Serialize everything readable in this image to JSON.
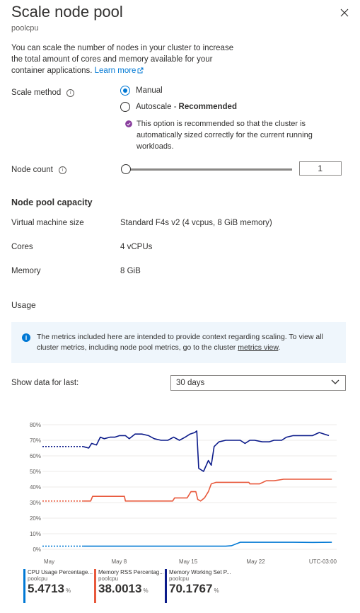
{
  "header": {
    "title": "Scale node pool",
    "subtitle": "poolcpu"
  },
  "description": {
    "text": "You can scale the number of nodes in your cluster to increase the total amount of cores and memory available for your container applications.",
    "link": "Learn more"
  },
  "scale_method": {
    "label": "Scale method",
    "options": [
      {
        "label": "Manual",
        "selected": true
      },
      {
        "label": "Autoscale - ",
        "bold": "Recommended",
        "selected": false
      }
    ],
    "note": "This option is recommended so that the cluster is automatically sized correctly for the current running workloads."
  },
  "node_count": {
    "label": "Node count",
    "value": "1"
  },
  "capacity": {
    "title": "Node pool capacity",
    "rows": [
      {
        "label": "Virtual machine size",
        "value": "Standard F4s v2 (4 vcpus, 8 GiB memory)"
      },
      {
        "label": "Cores",
        "value": "4 vCPUs"
      },
      {
        "label": "Memory",
        "value": "8 GiB"
      }
    ]
  },
  "usage": {
    "title": "Usage",
    "banner_text": "The metrics included here are intended to provide context regarding scaling. To view all cluster metrics, including node pool metrics, go to the cluster ",
    "banner_link": "metrics view",
    "banner_end": ".",
    "show_label": "Show data for last:",
    "period": "30 days"
  },
  "chart_data": {
    "type": "line",
    "y_ticks": [
      "80%",
      "70%",
      "60%",
      "50%",
      "40%",
      "30%",
      "20%",
      "10%",
      "0%"
    ],
    "x_ticks": [
      "May",
      "May 8",
      "May 15",
      "May 22"
    ],
    "timezone": "UTC-03:00",
    "ylim": [
      0,
      80
    ],
    "colors": {
      "cpu": "#0078d4",
      "rss": "#e8593c",
      "ws": "#0c1b8a"
    },
    "series": [
      {
        "name": "CPU Usage Percentage",
        "color": "#0078d4",
        "dotted": [
          [
            0,
            2
          ],
          [
            4.2,
            2
          ]
        ],
        "values": [
          [
            4.2,
            2
          ],
          [
            5,
            2
          ],
          [
            7,
            2
          ],
          [
            9,
            2
          ],
          [
            11,
            2
          ],
          [
            13,
            2
          ],
          [
            15,
            2
          ],
          [
            17,
            2
          ],
          [
            19,
            2
          ],
          [
            19.6,
            2.3
          ],
          [
            20.5,
            4.5
          ],
          [
            22,
            4.5
          ],
          [
            24,
            4.5
          ],
          [
            26,
            4.5
          ],
          [
            28,
            4.4
          ],
          [
            30,
            4.5
          ]
        ]
      },
      {
        "name": "Memory RSS Percentage",
        "color": "#e8593c",
        "dotted": [
          [
            0,
            31
          ],
          [
            4.2,
            31
          ]
        ],
        "values": [
          [
            4.2,
            31
          ],
          [
            5,
            31
          ],
          [
            5.2,
            34
          ],
          [
            6,
            34
          ],
          [
            7,
            34
          ],
          [
            8.5,
            34
          ],
          [
            8.6,
            31
          ],
          [
            10,
            31
          ],
          [
            13.5,
            31
          ],
          [
            13.7,
            33
          ],
          [
            15,
            33
          ],
          [
            15.4,
            37
          ],
          [
            15.9,
            37
          ],
          [
            16.1,
            32
          ],
          [
            16.4,
            31
          ],
          [
            16.8,
            33
          ],
          [
            17.2,
            37
          ],
          [
            17.5,
            42
          ],
          [
            18,
            43
          ],
          [
            20,
            43
          ],
          [
            21.4,
            43
          ],
          [
            21.5,
            42
          ],
          [
            22.5,
            42
          ],
          [
            23.2,
            44
          ],
          [
            24,
            44
          ],
          [
            25,
            45
          ],
          [
            27,
            45
          ],
          [
            28.5,
            45
          ],
          [
            30,
            45
          ]
        ]
      },
      {
        "name": "Memory Working Set Percentage",
        "color": "#0c1b8a",
        "dotted": [
          [
            0,
            66
          ],
          [
            4.2,
            66
          ]
        ],
        "values": [
          [
            4.2,
            66
          ],
          [
            4.8,
            65
          ],
          [
            5.1,
            68
          ],
          [
            5.6,
            67
          ],
          [
            6,
            72
          ],
          [
            6.4,
            71
          ],
          [
            7,
            72
          ],
          [
            7.5,
            72
          ],
          [
            8,
            73
          ],
          [
            8.6,
            73
          ],
          [
            9,
            71
          ],
          [
            9.6,
            74
          ],
          [
            10.3,
            74
          ],
          [
            11,
            73
          ],
          [
            11.6,
            71
          ],
          [
            12.3,
            70
          ],
          [
            13,
            70
          ],
          [
            13.6,
            72
          ],
          [
            14.2,
            70
          ],
          [
            14.8,
            72
          ],
          [
            15.3,
            74
          ],
          [
            15.8,
            75
          ],
          [
            16,
            76
          ],
          [
            16.2,
            52
          ],
          [
            16.7,
            50
          ],
          [
            17.2,
            57
          ],
          [
            17.5,
            54
          ],
          [
            17.8,
            66
          ],
          [
            18.3,
            69
          ],
          [
            19,
            70
          ],
          [
            20,
            70
          ],
          [
            20.5,
            70
          ],
          [
            21,
            68
          ],
          [
            21.5,
            70
          ],
          [
            22,
            70
          ],
          [
            22.8,
            69
          ],
          [
            23.5,
            69
          ],
          [
            24,
            70
          ],
          [
            24.8,
            70
          ],
          [
            25.3,
            72
          ],
          [
            26,
            73
          ],
          [
            27,
            73
          ],
          [
            28,
            73
          ],
          [
            28.7,
            75
          ],
          [
            29.2,
            74
          ],
          [
            29.7,
            73
          ]
        ]
      }
    ]
  },
  "legend": [
    {
      "name": "CPU Usage Percentage...",
      "sub": "poolcpu",
      "value": "5.4713",
      "unit": "%",
      "color": "#0078d4"
    },
    {
      "name": "Memory RSS Percentag...",
      "sub": "poolcpu",
      "value": "38.0013",
      "unit": "%",
      "color": "#e8593c"
    },
    {
      "name": "Memory Working Set P...",
      "sub": "poolcpu",
      "value": "70.1767",
      "unit": "%",
      "color": "#0c1b8a"
    }
  ]
}
